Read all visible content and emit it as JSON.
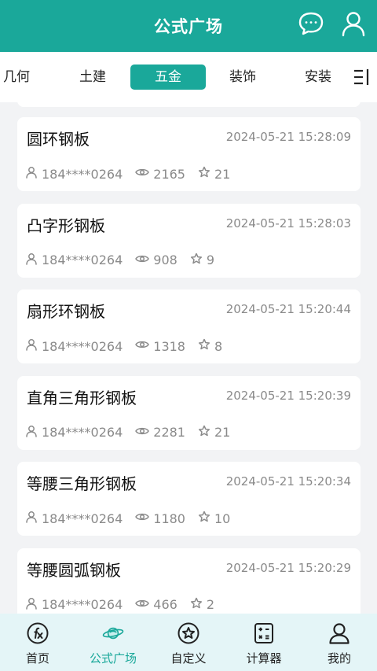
{
  "header": {
    "title": "公式广场",
    "icons": [
      "message-icon",
      "user-icon"
    ]
  },
  "tabs": [
    {
      "label": "几何"
    },
    {
      "label": "土建"
    },
    {
      "label": "五金",
      "active": true
    },
    {
      "label": "装饰"
    },
    {
      "label": "安装"
    }
  ],
  "items": [
    {
      "title": "圆环钢板",
      "time": "2024-05-21 15:28:09",
      "user": "184****0264",
      "views": "2165",
      "stars": "21"
    },
    {
      "title": "凸字形钢板",
      "time": "2024-05-21 15:28:03",
      "user": "184****0264",
      "views": "908",
      "stars": "9"
    },
    {
      "title": "扇形环钢板",
      "time": "2024-05-21 15:20:44",
      "user": "184****0264",
      "views": "1318",
      "stars": "8"
    },
    {
      "title": "直角三角形钢板",
      "time": "2024-05-21 15:20:39",
      "user": "184****0264",
      "views": "2281",
      "stars": "21"
    },
    {
      "title": "等腰三角形钢板",
      "time": "2024-05-21 15:20:34",
      "user": "184****0264",
      "views": "1180",
      "stars": "10"
    },
    {
      "title": "等腰圆弧钢板",
      "time": "2024-05-21 15:20:29",
      "user": "184****0264",
      "views": "466",
      "stars": "2"
    }
  ],
  "nav": [
    {
      "label": "首页",
      "icon": "fx-icon"
    },
    {
      "label": "公式广场",
      "icon": "planet-icon",
      "active": true
    },
    {
      "label": "自定义",
      "icon": "star-circle-icon"
    },
    {
      "label": "计算器",
      "icon": "calculator-icon"
    },
    {
      "label": "我的",
      "icon": "profile-icon"
    }
  ],
  "colors": {
    "primary": "#1aa89a",
    "background": "#f2f3f5",
    "nav_background": "#e4f5f7",
    "muted_text": "#8a8a8a"
  }
}
